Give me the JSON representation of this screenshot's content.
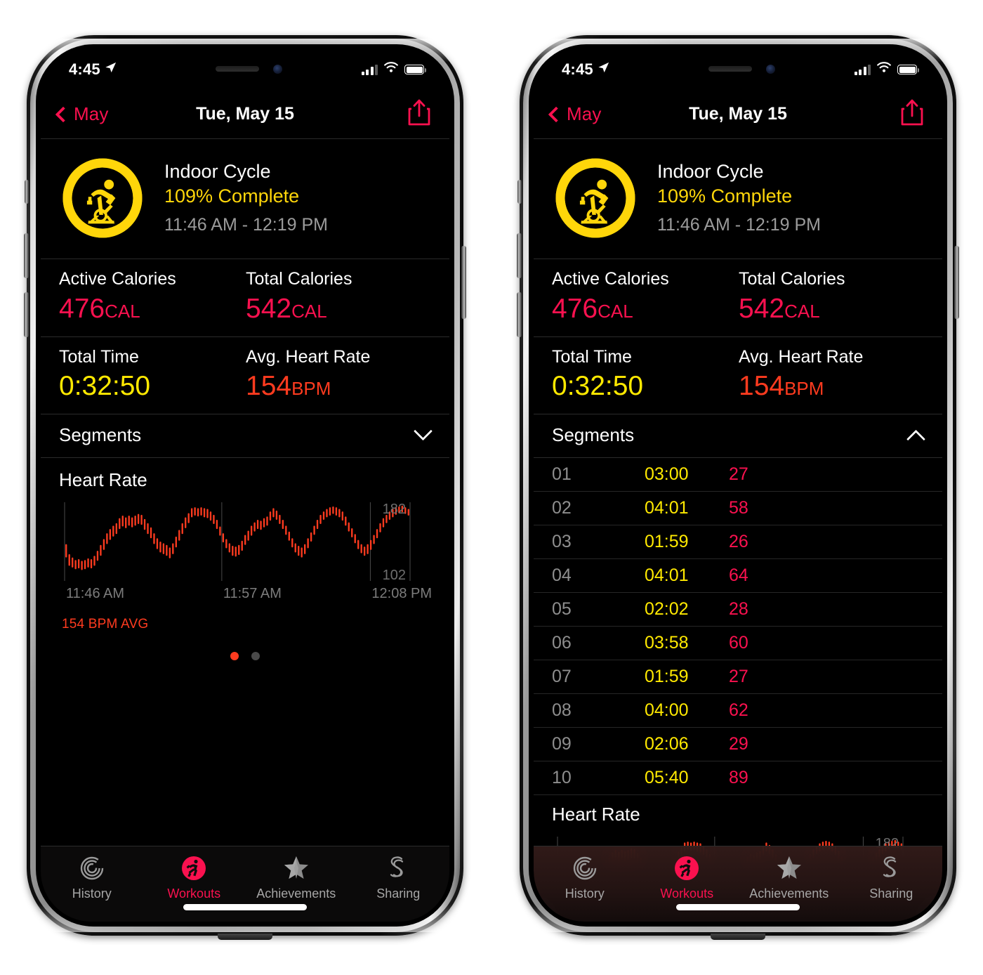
{
  "status_bar": {
    "time": "4:45",
    "location_icon": "location-arrow-icon",
    "signal_icon": "cellular-signal-icon",
    "wifi_icon": "wifi-icon",
    "battery_icon": "battery-icon"
  },
  "nav": {
    "back_label": "May",
    "back_icon": "chevron-left-icon",
    "title": "Tue, May 15",
    "share_icon": "share-icon"
  },
  "workout": {
    "activity_icon": "indoor-cycle-icon",
    "ring_color": "#FFD60A",
    "title": "Indoor Cycle",
    "percent_complete": "109% Complete",
    "time_range": "11:46 AM - 12:19 PM",
    "ring_percent": 109
  },
  "stats": [
    {
      "label": "Active Calories",
      "value": "476",
      "unit": "CAL",
      "color": "#FA114F",
      "label2": "Total Calories",
      "value2": "542",
      "unit2": "CAL",
      "color2": "#FA114F"
    },
    {
      "label": "Total Time",
      "value": "0:32:50",
      "unit": "",
      "color": "#FFE900",
      "label2": "Avg. Heart Rate",
      "value2": "154",
      "unit2": "BPM",
      "color2": "#FF3B1F"
    }
  ],
  "segments": {
    "title": "Segments",
    "collapsed_icon": "chevron-down-icon",
    "expanded_icon": "chevron-up-icon",
    "rows": [
      {
        "index": "01",
        "duration": "03:00",
        "calories": "27"
      },
      {
        "index": "02",
        "duration": "04:01",
        "calories": "58"
      },
      {
        "index": "03",
        "duration": "01:59",
        "calories": "26"
      },
      {
        "index": "04",
        "duration": "04:01",
        "calories": "64"
      },
      {
        "index": "05",
        "duration": "02:02",
        "calories": "28"
      },
      {
        "index": "06",
        "duration": "03:58",
        "calories": "60"
      },
      {
        "index": "07",
        "duration": "01:59",
        "calories": "27"
      },
      {
        "index": "08",
        "duration": "04:00",
        "calories": "62"
      },
      {
        "index": "09",
        "duration": "02:06",
        "calories": "29"
      },
      {
        "index": "10",
        "duration": "05:40",
        "calories": "89"
      }
    ]
  },
  "heart_rate": {
    "title": "Heart Rate",
    "avg_label": "154 BPM AVG",
    "page_dots": 2,
    "active_dot": 0
  },
  "chart_data": {
    "type": "area",
    "title": "Heart Rate",
    "xlabel": "",
    "ylabel": "BPM",
    "ylim": [
      102,
      182
    ],
    "y_tick_labels": [
      "182",
      "102"
    ],
    "x_tick_labels": [
      "11:46 AM",
      "11:57 AM",
      "12:08 PM"
    ],
    "annotation": "154 BPM AVG",
    "series_color": "#FF3B1F",
    "grid": false,
    "legend": "none",
    "note": "Vertical capsule bars showing per-bucket min/max heart rate over the workout",
    "bars_min": [
      122,
      112,
      110,
      108,
      109,
      107,
      108,
      110,
      109,
      112,
      118,
      124,
      131,
      138,
      143,
      147,
      150,
      156,
      159,
      157,
      160,
      158,
      160,
      162,
      161,
      155,
      150,
      145,
      138,
      132,
      128,
      126,
      124,
      121,
      126,
      134,
      142,
      150,
      157,
      163,
      170,
      172,
      171,
      172,
      170,
      169,
      166,
      162,
      156,
      148,
      140,
      133,
      128,
      124,
      123,
      125,
      130,
      137,
      142,
      148,
      153,
      156,
      155,
      158,
      160,
      166,
      170,
      167,
      162,
      156,
      149,
      142,
      134,
      128,
      124,
      122,
      126,
      133,
      141,
      149,
      156,
      162,
      167,
      170,
      172,
      174,
      172,
      170,
      166,
      160,
      153,
      146,
      139,
      132,
      127,
      124,
      126,
      131,
      138,
      145,
      152,
      158,
      163,
      167,
      170,
      173,
      175,
      176,
      174,
      172
    ],
    "bars_max": [
      138,
      126,
      122,
      119,
      120,
      118,
      119,
      121,
      120,
      124,
      130,
      137,
      144,
      151,
      156,
      160,
      163,
      169,
      172,
      170,
      172,
      170,
      172,
      174,
      173,
      168,
      163,
      158,
      151,
      145,
      141,
      139,
      137,
      134,
      139,
      147,
      155,
      163,
      170,
      175,
      181,
      182,
      181,
      182,
      181,
      180,
      177,
      173,
      167,
      159,
      151,
      144,
      139,
      136,
      135,
      137,
      142,
      149,
      154,
      160,
      164,
      167,
      166,
      169,
      171,
      177,
      181,
      178,
      173,
      167,
      160,
      153,
      145,
      139,
      136,
      134,
      138,
      145,
      152,
      160,
      167,
      173,
      177,
      180,
      182,
      183,
      182,
      180,
      177,
      171,
      164,
      157,
      150,
      143,
      138,
      135,
      138,
      143,
      149,
      156,
      163,
      169,
      173,
      177,
      180,
      182,
      183,
      184,
      182,
      180
    ]
  },
  "tabbar": {
    "tabs": [
      {
        "label": "History",
        "icon": "activity-rings-icon",
        "active": false
      },
      {
        "label": "Workouts",
        "icon": "running-person-icon",
        "active": true
      },
      {
        "label": "Achievements",
        "icon": "star-award-icon",
        "active": false
      },
      {
        "label": "Sharing",
        "icon": "sharing-s-icon",
        "active": false
      }
    ]
  },
  "colors": {
    "pink": "#FA114F",
    "yellow": "#FFE900",
    "ring_yellow": "#FFD60A",
    "red": "#FF3B1F",
    "gray": "#8e8e8e"
  }
}
